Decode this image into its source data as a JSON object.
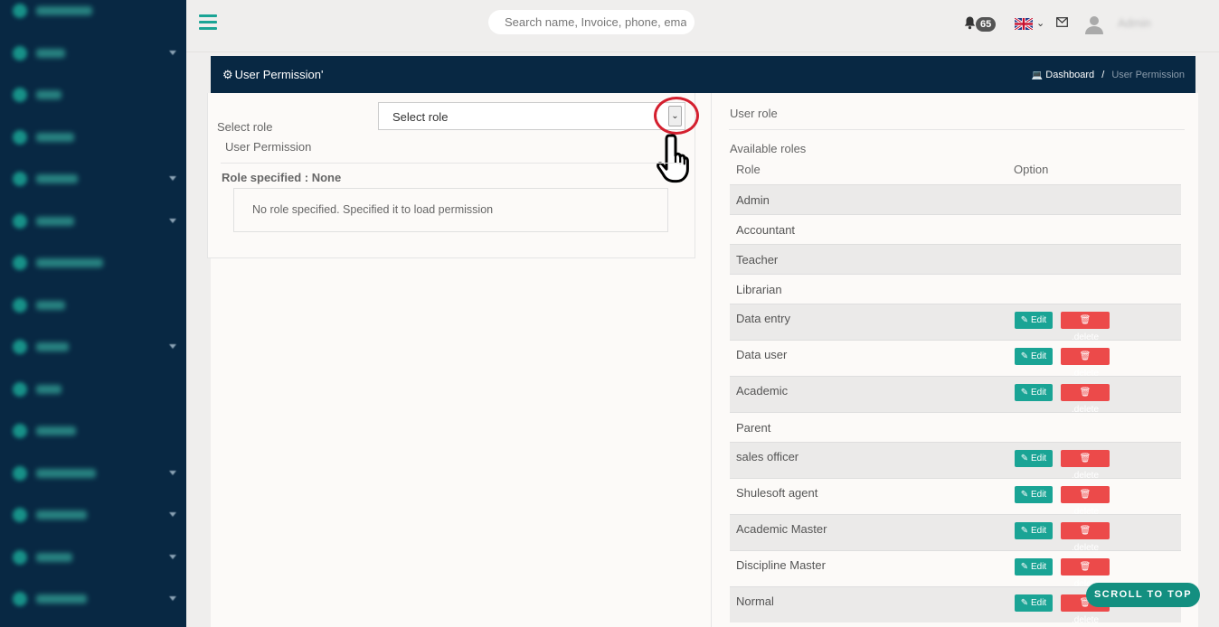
{
  "sidebar": {
    "items": [
      {
        "icon": "dashboard-icon",
        "caret": false
      },
      {
        "icon": "admin-icon",
        "caret": true
      },
      {
        "icon": "users-icon",
        "caret": false
      },
      {
        "icon": "students-icon",
        "caret": false
      },
      {
        "icon": "subjects-icon",
        "caret": true
      },
      {
        "icon": "teachers-icon",
        "caret": true
      },
      {
        "icon": "exam-icon",
        "caret": false
      },
      {
        "icon": "reports-icon",
        "caret": false
      },
      {
        "icon": "accounts-icon",
        "caret": true
      },
      {
        "icon": "library-icon",
        "caret": false
      },
      {
        "icon": "routine-icon",
        "caret": false
      },
      {
        "icon": "attendance-icon",
        "caret": true
      },
      {
        "icon": "messages-icon",
        "caret": true
      },
      {
        "icon": "settings-icon",
        "caret": true
      },
      {
        "icon": "transport-icon",
        "caret": true
      }
    ]
  },
  "topbar": {
    "search_placeholder": "Search name, Invoice, phone, email",
    "notifications_count": "65",
    "user_name": "Admin"
  },
  "header": {
    "title": "User Permission'",
    "breadcrumb_home": "Dashboard",
    "breadcrumb_sep": "/",
    "breadcrumb_current": "User Permission"
  },
  "left": {
    "select_label": "Select role",
    "select_value": "Select role",
    "subtitle": "User Permission",
    "role_specified": "Role specified : None",
    "notice": "No role specified. Specified it to load permission"
  },
  "right": {
    "title": "User role",
    "available": "Available roles",
    "col_role": "Role",
    "col_option": "Option",
    "edit_label": "Edit",
    "delete_label": ".delete",
    "roles": [
      {
        "name": "Admin",
        "actions": false
      },
      {
        "name": "Accountant",
        "actions": false
      },
      {
        "name": "Teacher",
        "actions": false
      },
      {
        "name": "Librarian",
        "actions": false
      },
      {
        "name": "Data entry",
        "actions": true
      },
      {
        "name": "Data user",
        "actions": true
      },
      {
        "name": "Academic",
        "actions": true
      },
      {
        "name": "Parent",
        "actions": false
      },
      {
        "name": "sales officer",
        "actions": true
      },
      {
        "name": "Shulesoft agent",
        "actions": true
      },
      {
        "name": "Academic Master",
        "actions": true
      },
      {
        "name": "Discipline Master",
        "actions": true
      },
      {
        "name": "Normal",
        "actions": true
      }
    ]
  },
  "scroll_top": "SCROLL TO TOP",
  "colors": {
    "sidebar": "#082843",
    "accent": "#1aa495",
    "danger": "#ec4a4a",
    "highlight": "#d4202f"
  }
}
